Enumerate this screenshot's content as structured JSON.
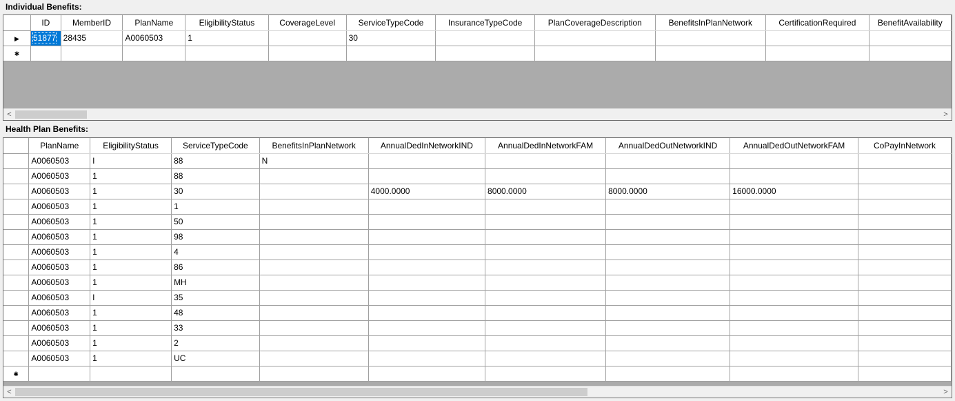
{
  "individual": {
    "label": "Individual Benefits:",
    "columns": [
      "ID",
      "MemberID",
      "PlanName",
      "EligibilityStatus",
      "CoverageLevel",
      "ServiceTypeCode",
      "InsuranceTypeCode",
      "PlanCoverageDescription",
      "BenefitsInPlanNetwork",
      "CertificationRequired",
      "BenefitAvailability"
    ],
    "rows": [
      [
        "51877",
        "28435",
        "A0060503",
        "1",
        "",
        "30",
        "",
        "",
        "",
        "",
        ""
      ]
    ],
    "current_row_glyph": "▶",
    "new_row_glyph": "✱",
    "scroll_left": "<",
    "scroll_right": ">"
  },
  "health": {
    "label": "Health Plan Benefits:",
    "columns": [
      "PlanName",
      "EligibilityStatus",
      "ServiceTypeCode",
      "BenefitsInPlanNetwork",
      "AnnualDedInNetworkIND",
      "AnnualDedInNetworkFAM",
      "AnnualDedOutNetworkIND",
      "AnnualDedOutNetworkFAM",
      "CoPayInNetwork"
    ],
    "rows": [
      [
        "A0060503",
        "I",
        "88",
        "N",
        "",
        "",
        "",
        "",
        ""
      ],
      [
        "A0060503",
        "1",
        "88",
        "",
        "",
        "",
        "",
        "",
        ""
      ],
      [
        "A0060503",
        "1",
        "30",
        "",
        "4000.0000",
        "8000.0000",
        "8000.0000",
        "16000.0000",
        ""
      ],
      [
        "A0060503",
        "1",
        "1",
        "",
        "",
        "",
        "",
        "",
        ""
      ],
      [
        "A0060503",
        "1",
        "50",
        "",
        "",
        "",
        "",
        "",
        ""
      ],
      [
        "A0060503",
        "1",
        "98",
        "",
        "",
        "",
        "",
        "",
        ""
      ],
      [
        "A0060503",
        "1",
        "4",
        "",
        "",
        "",
        "",
        "",
        ""
      ],
      [
        "A0060503",
        "1",
        "86",
        "",
        "",
        "",
        "",
        "",
        ""
      ],
      [
        "A0060503",
        "1",
        "MH",
        "",
        "",
        "",
        "",
        "",
        ""
      ],
      [
        "A0060503",
        "I",
        "35",
        "",
        "",
        "",
        "",
        "",
        ""
      ],
      [
        "A0060503",
        "1",
        "48",
        "",
        "",
        "",
        "",
        "",
        ""
      ],
      [
        "A0060503",
        "1",
        "33",
        "",
        "",
        "",
        "",
        "",
        ""
      ],
      [
        "A0060503",
        "1",
        "2",
        "",
        "",
        "",
        "",
        "",
        ""
      ],
      [
        "A0060503",
        "1",
        "UC",
        "",
        "",
        "",
        "",
        "",
        ""
      ]
    ],
    "new_row_glyph": "✱",
    "scroll_left": "<",
    "scroll_right": ">"
  }
}
